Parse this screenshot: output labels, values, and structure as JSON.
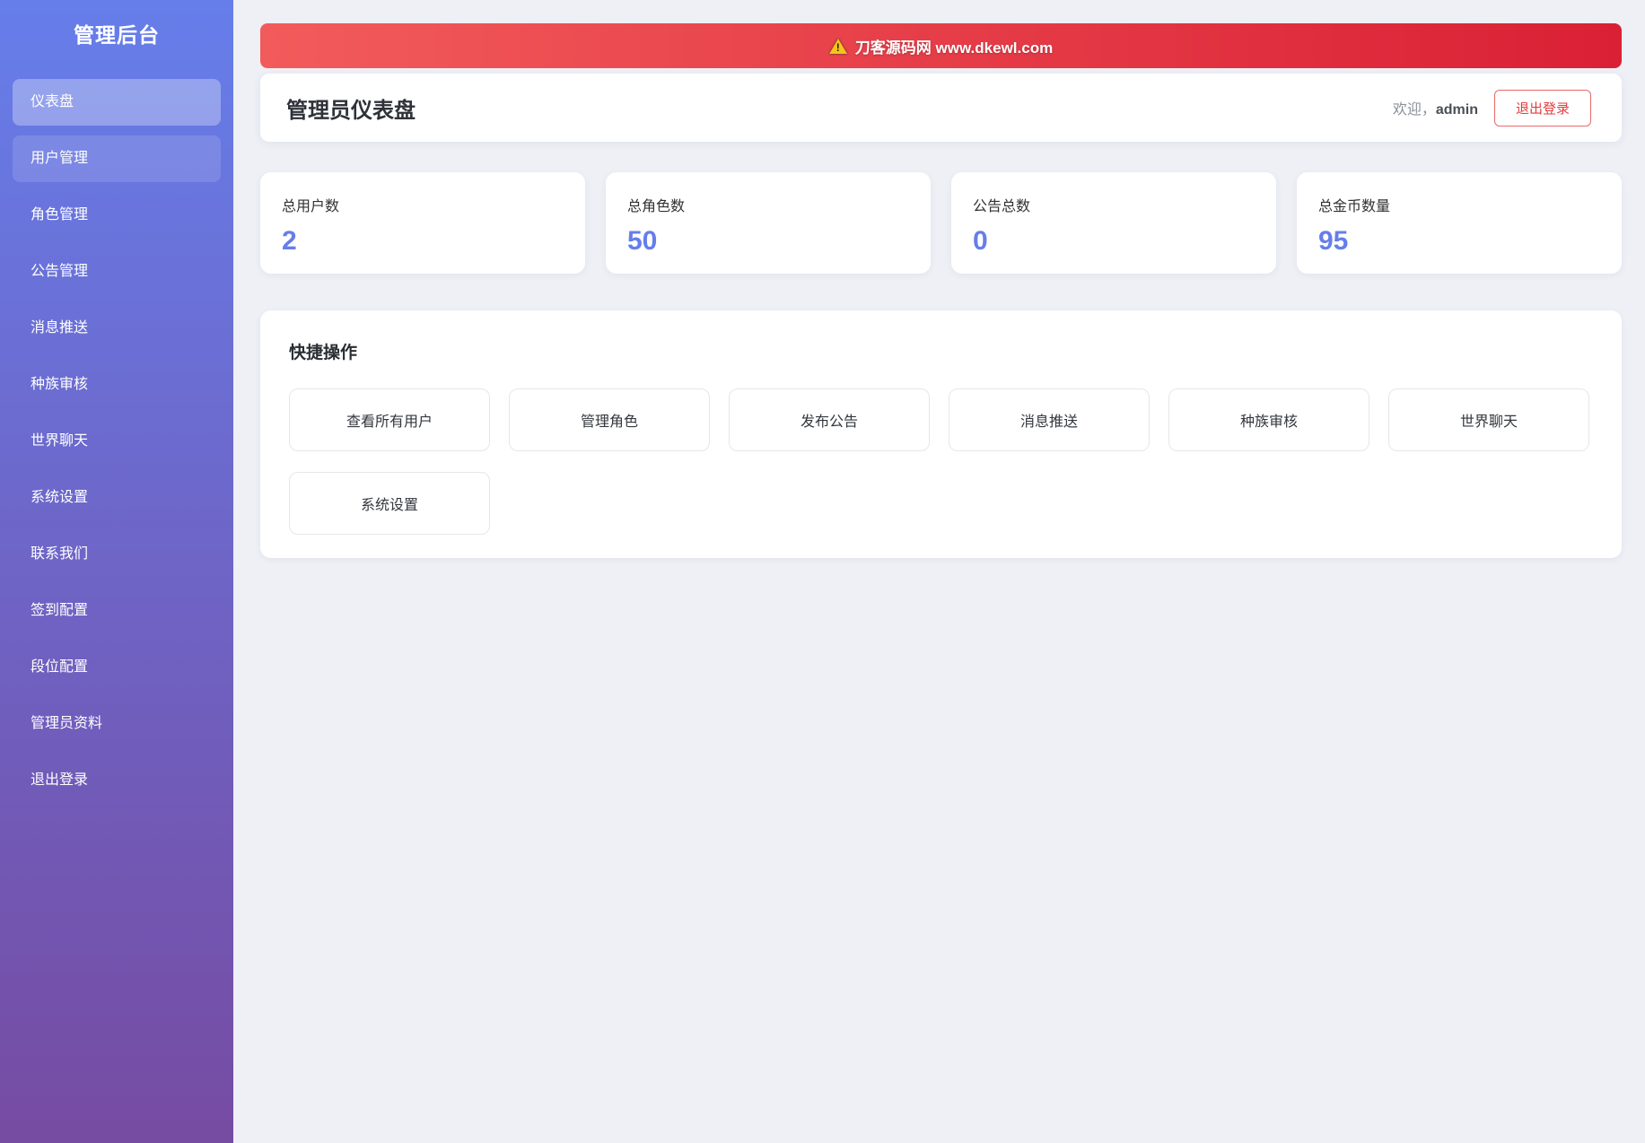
{
  "sidebar": {
    "title": "管理后台",
    "items": [
      {
        "label": "仪表盘"
      },
      {
        "label": "用户管理"
      },
      {
        "label": "角色管理"
      },
      {
        "label": "公告管理"
      },
      {
        "label": "消息推送"
      },
      {
        "label": "种族审核"
      },
      {
        "label": "世界聊天"
      },
      {
        "label": "系统设置"
      },
      {
        "label": "联系我们"
      },
      {
        "label": "签到配置"
      },
      {
        "label": "段位配置"
      },
      {
        "label": "管理员资料"
      },
      {
        "label": "退出登录"
      }
    ]
  },
  "banner": {
    "text": "刀客源码网 www.dkewl.com"
  },
  "header": {
    "title": "管理员仪表盘",
    "welcome_prefix": "欢迎，",
    "username": "admin",
    "logout_label": "退出登录"
  },
  "stats": {
    "cards": [
      {
        "label": "总用户数",
        "value": "2"
      },
      {
        "label": "总角色数",
        "value": "50"
      },
      {
        "label": "公告总数",
        "value": "0"
      },
      {
        "label": "总金币数量",
        "value": "95"
      }
    ]
  },
  "quick_actions": {
    "title": "快捷操作",
    "buttons": [
      "查看所有用户",
      "管理角色",
      "发布公告",
      "消息推送",
      "种族审核",
      "世界聊天",
      "系统设置"
    ]
  },
  "colors": {
    "accent": "#667eea",
    "sidebar_gradient_start": "#667eea",
    "sidebar_gradient_end": "#764ba2",
    "banner_red_start": "#f25b5b",
    "banner_red_end": "#da2035",
    "logout_red": "#e23c3c"
  }
}
